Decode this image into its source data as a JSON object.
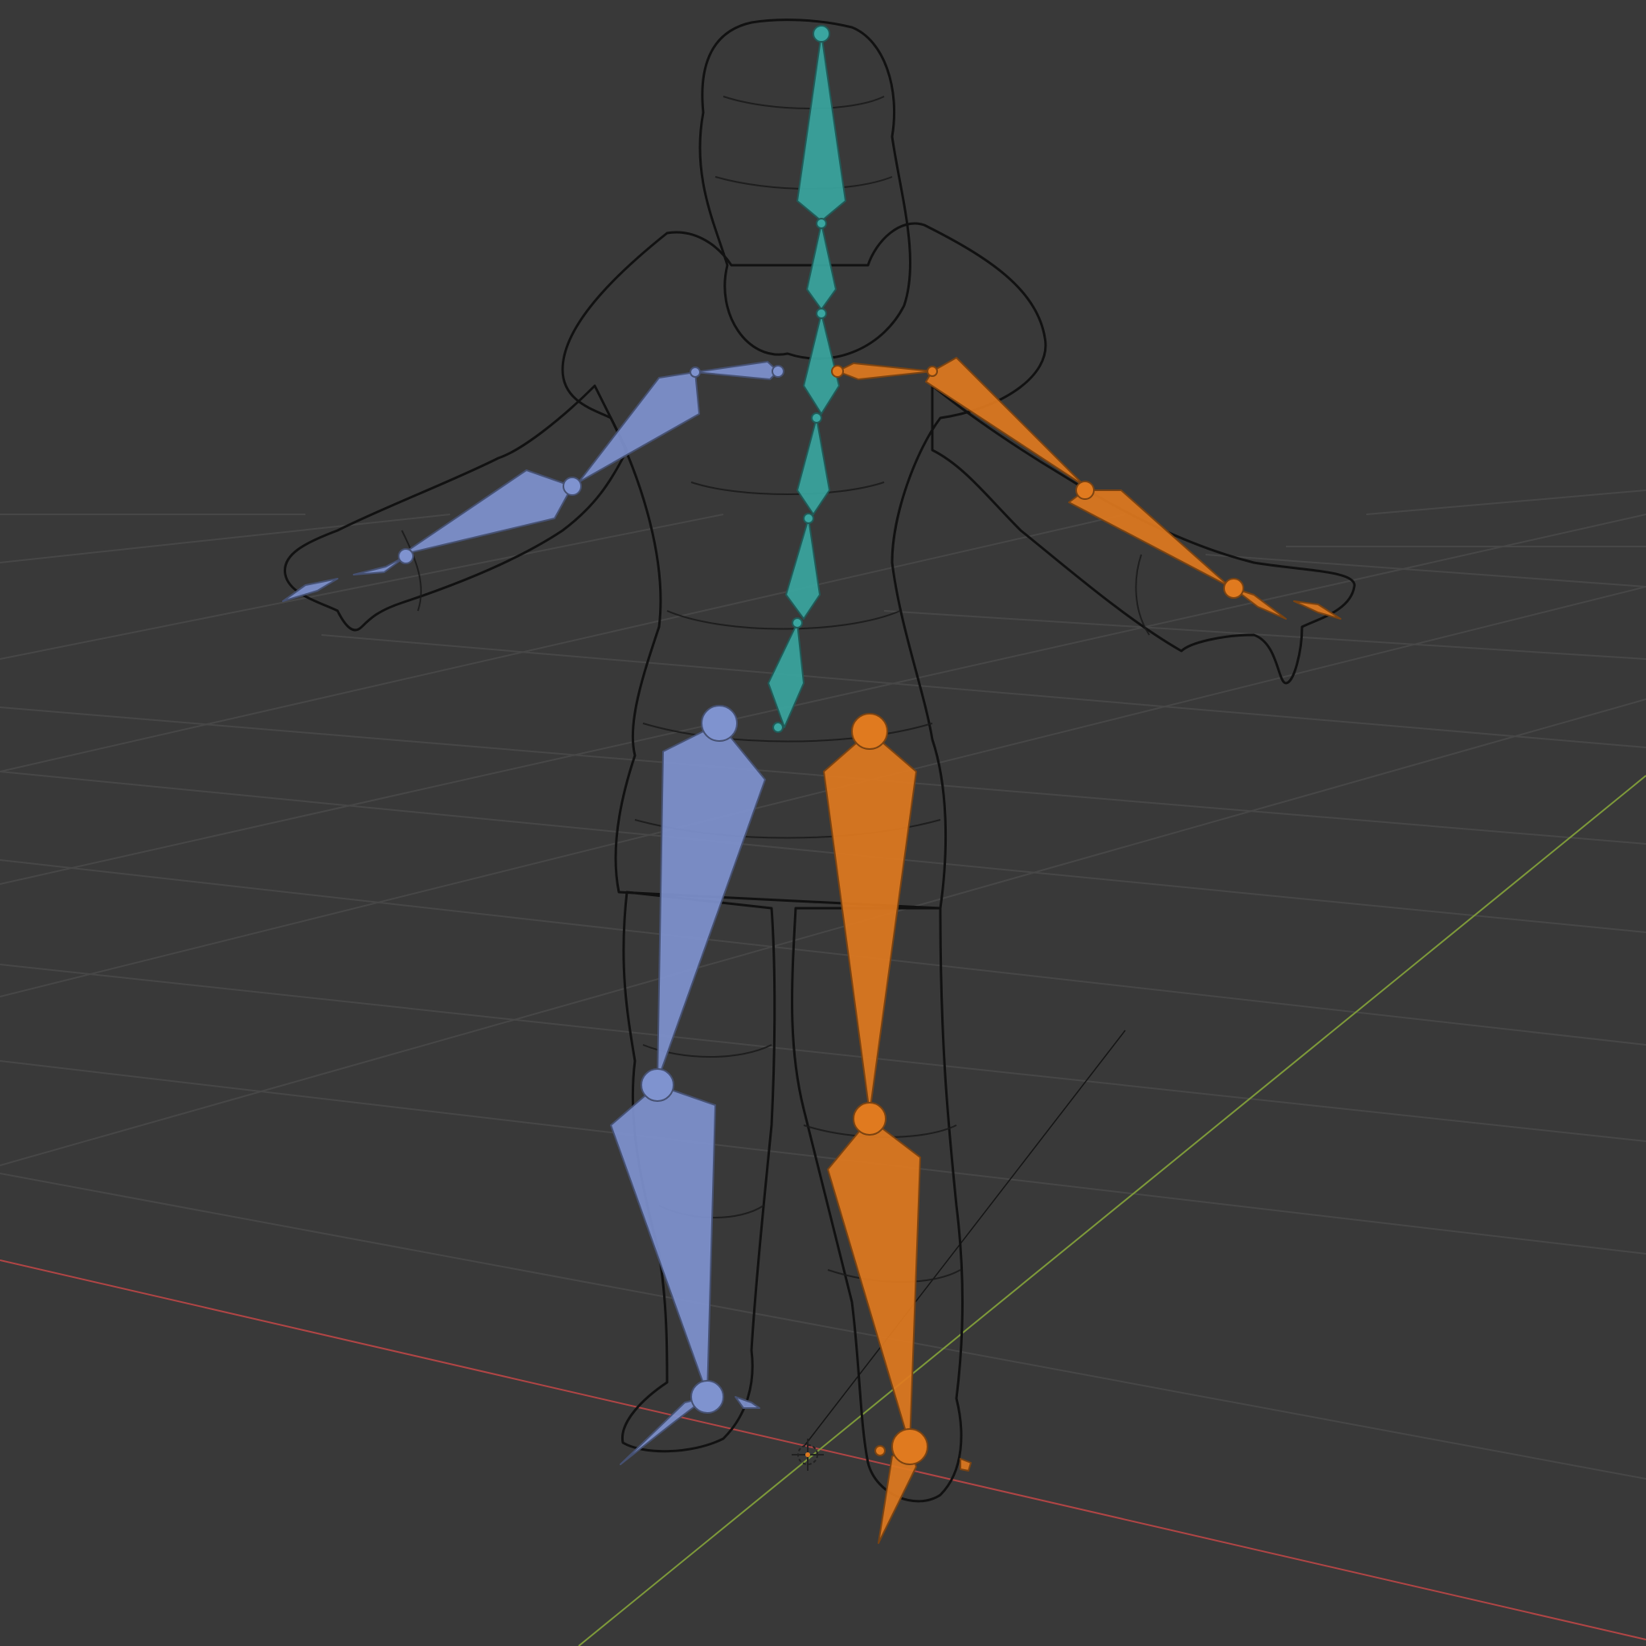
{
  "scene": {
    "background_color": "#393939",
    "grid_color": "#474747",
    "axis_x_color": "#b04545",
    "axis_y_color": "#7e9a3a",
    "mesh_wire_color": "#111111",
    "origin_icon": "3d-cursor-icon"
  },
  "armature": {
    "center_color": "#3aa6a0",
    "left_color": "#7f93cf",
    "right_color": "#e07a1f"
  }
}
